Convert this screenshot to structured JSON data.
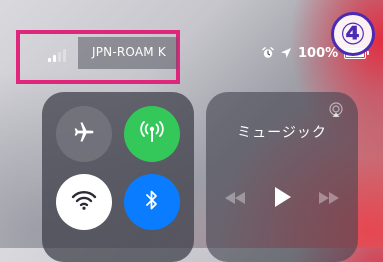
{
  "status_bar": {
    "carrier": "JPN-ROAM K",
    "battery_percent": "100%",
    "signal_bars_active": 2,
    "signal_bars_total": 4
  },
  "step_badge": "④",
  "connectivity": {
    "airplane_mode": false,
    "cellular_data": true,
    "wifi": true,
    "bluetooth": true,
    "colors": {
      "cellular": "#34c759",
      "wifi": "#ffffff",
      "bluetooth": "#0a7cff",
      "highlight": "#e0257c"
    }
  },
  "music": {
    "title": "ミュージック",
    "playing": false
  }
}
